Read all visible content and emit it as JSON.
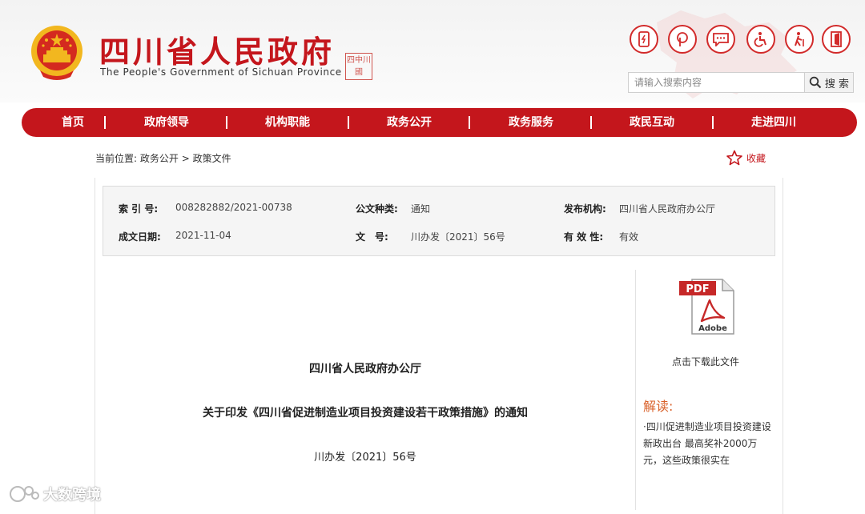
{
  "header": {
    "title": "四川省人民政府",
    "subtitle": "The People's Government of Sichuan Province",
    "seal_text": "四中川國"
  },
  "icons": [
    "mobile-icon",
    "weibo-icon",
    "chat-icon",
    "accessibility-icon",
    "elderly-icon",
    "exit-icon"
  ],
  "search": {
    "placeholder": "请输入搜索内容",
    "button_label": "搜 索"
  },
  "nav": {
    "items": [
      "首页",
      "政府领导",
      "机构职能",
      "政务公开",
      "政务服务",
      "政民互动",
      "走进四川"
    ]
  },
  "breadcrumb": {
    "prefix": "当前位置:",
    "items": [
      "政务公开",
      "政策文件"
    ],
    "separator": ">"
  },
  "favorite_label": "收藏",
  "info": {
    "index_label": "索 引 号:",
    "index_value": "008282882/2021-00738",
    "type_label": "公文种类:",
    "type_value": "通知",
    "org_label": "发布机构:",
    "org_value": "四川省人民政府办公厅",
    "date_label": "成文日期:",
    "date_value": "2021-11-04",
    "num_label": "文　号:",
    "num_value": "川办发〔2021〕56号",
    "valid_label": "有 效 性:",
    "valid_value": "有效"
  },
  "sidebar": {
    "pdf_label": "PDF",
    "adobe_label": "Adobe",
    "download_label": "点击下载此文件",
    "jiedu_title": "解读:",
    "jiedu_text": "·四川促进制造业项目投资建设新政出台 最高奖补2000万元，这些政策很实在"
  },
  "document": {
    "issuer": "四川省人民政府办公厅",
    "title": "关于印发《四川省促进制造业项目投资建设若干政策措施》的通知",
    "number": "川办发〔2021〕56号"
  },
  "watermark": "大数跨境",
  "colors": {
    "brand_red": "#c4161c",
    "accent_orange": "#d9622b"
  }
}
